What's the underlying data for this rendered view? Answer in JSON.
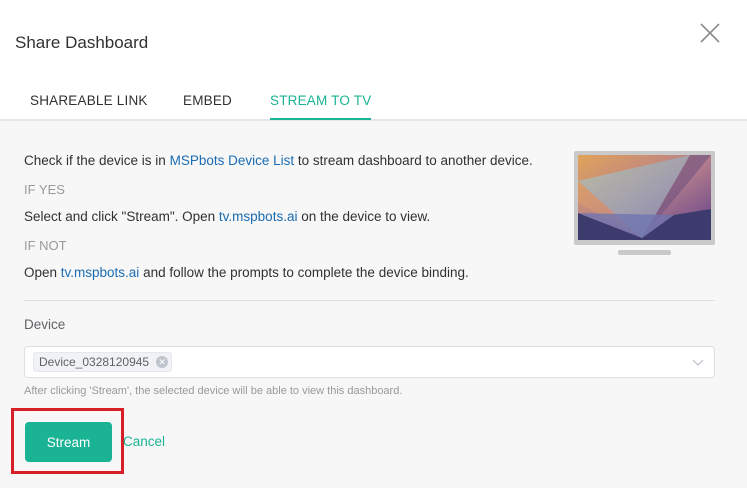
{
  "dialog": {
    "title": "Share Dashboard"
  },
  "tabs": [
    {
      "label": "SHAREABLE LINK",
      "active": false
    },
    {
      "label": "EMBED",
      "active": false
    },
    {
      "label": "STREAM TO TV",
      "active": true
    }
  ],
  "instructions": {
    "line1": {
      "before": "Check if the device is in ",
      "link": "MSPbots Device List",
      "after": " to stream dashboard to another device."
    },
    "if_yes": "IF YES",
    "line2": {
      "before": "Select and click \"Stream\". Open ",
      "link": "tv.mspbots.ai",
      "after": " on the device to view."
    },
    "if_not": "IF NOT",
    "line3": {
      "before": "Open ",
      "link": "tv.mspbots.ai",
      "after": " and follow the prompts to complete the device binding."
    }
  },
  "device": {
    "label": "Device",
    "selected": [
      "Device_0328120945"
    ],
    "hint": "After clicking 'Stream', the selected device will be able to view this dashboard."
  },
  "actions": {
    "stream_label": "Stream",
    "cancel_label": "Cancel"
  },
  "colors": {
    "accent": "#1ab394",
    "link": "#1a6cb3",
    "highlight_box": "#d61f26"
  },
  "icons": {
    "close": "close-icon",
    "tv": "tv-illustration",
    "tag_remove": "remove-tag-icon",
    "dropdown": "chevron-down-icon"
  }
}
